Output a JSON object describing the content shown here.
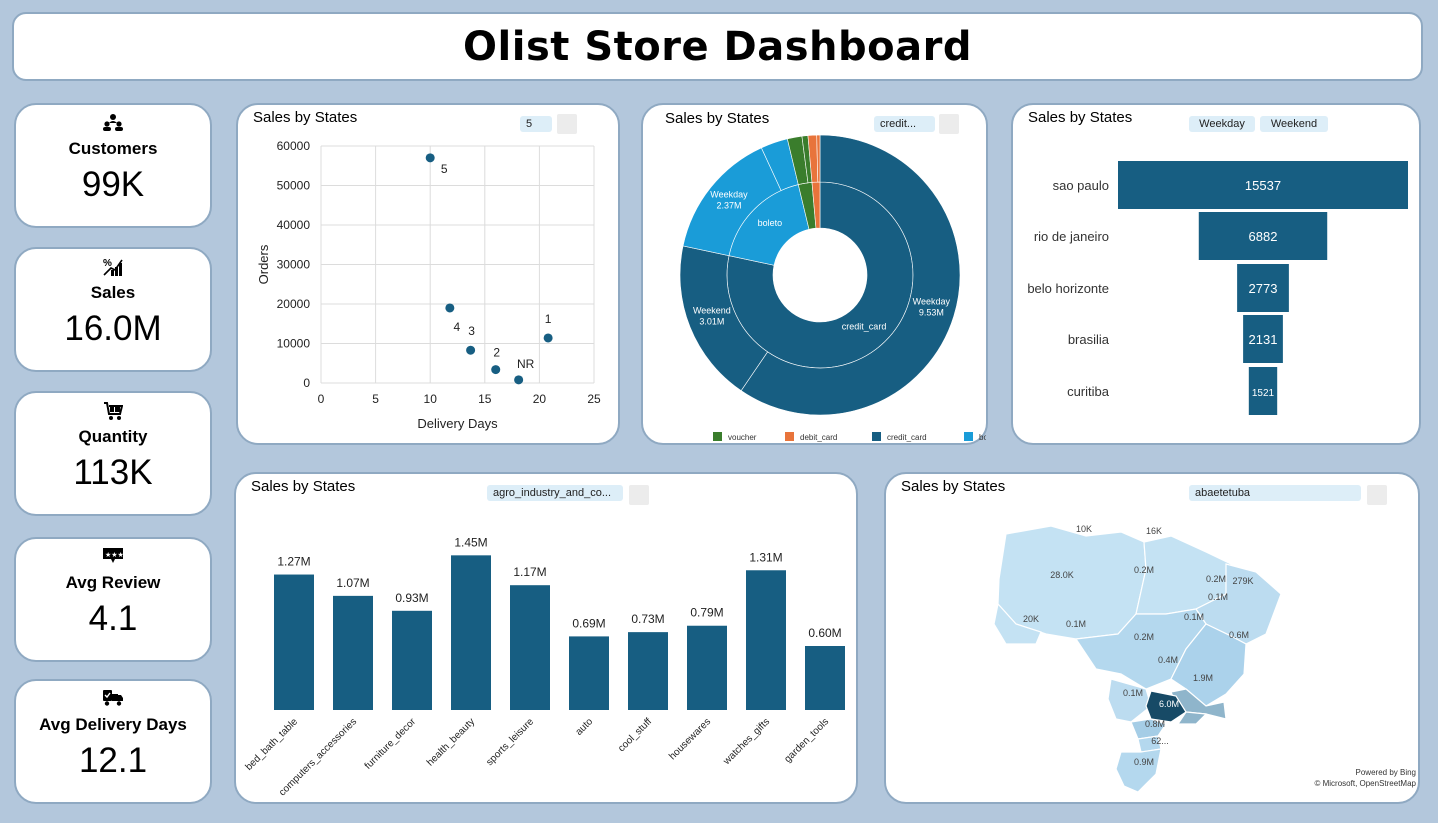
{
  "header": {
    "title": "Olist Store Dashboard"
  },
  "kpis": {
    "customers": {
      "label": "Customers",
      "value": "99K",
      "icon": "people-icon"
    },
    "sales": {
      "label": "Sales",
      "value": "16.0M",
      "icon": "sales-growth-icon"
    },
    "quantity": {
      "label": "Quantity",
      "value": "113K",
      "icon": "cart-icon"
    },
    "avg_review": {
      "label": "Avg Review",
      "value": "4.1",
      "icon": "star-review-icon"
    },
    "avg_delivery": {
      "label": "Avg Delivery Days",
      "value": "12.1",
      "icon": "delivery-truck-icon"
    }
  },
  "scatter": {
    "title": "Sales by States",
    "slicer": "5",
    "chart_data": {
      "type": "scatter",
      "xlabel": "Delivery Days",
      "ylabel": "Orders",
      "xlim": [
        0,
        25
      ],
      "ylim": [
        0,
        60000
      ],
      "x_ticks": [
        "0",
        "5",
        "10",
        "15",
        "20",
        "25"
      ],
      "y_ticks": [
        "0",
        "10000",
        "20000",
        "30000",
        "40000",
        "50000",
        "60000"
      ],
      "points": [
        {
          "label": "5",
          "x": 10.0,
          "y": 57000
        },
        {
          "label": "4",
          "x": 11.8,
          "y": 19000
        },
        {
          "label": "3",
          "x": 13.7,
          "y": 8300
        },
        {
          "label": "2",
          "x": 16.0,
          "y": 3400
        },
        {
          "label": "NR",
          "x": 18.1,
          "y": 800
        },
        {
          "label": "1",
          "x": 20.8,
          "y": 11400
        }
      ]
    }
  },
  "donut": {
    "title": "Sales by States",
    "slicer": "credit...",
    "legend": [
      {
        "label": "voucher",
        "color": "#3a7d2c"
      },
      {
        "label": "debit_card",
        "color": "#e8743b"
      },
      {
        "label": "credit_card",
        "color": "#175e82"
      },
      {
        "label": "boleto",
        "color": "#1a9cd8"
      }
    ],
    "chart_data": {
      "type": "pie",
      "inner": [
        {
          "label": "credit_card",
          "value": 12.54,
          "color": "#175e82"
        },
        {
          "label": "boleto",
          "value": 2.87,
          "color": "#1a9cd8"
        },
        {
          "label": "voucher",
          "value": 0.38,
          "color": "#3a7d2c"
        },
        {
          "label": "debit_card",
          "value": 0.22,
          "color": "#e8743b"
        }
      ],
      "outer": [
        {
          "label": "Weekday",
          "value_label": "9.53M",
          "value": 9.53,
          "color": "#175e82"
        },
        {
          "label": "Weekend",
          "value_label": "3.01M",
          "value": 3.01,
          "color": "#175e82"
        },
        {
          "label": "Weekday",
          "value_label": "2.37M",
          "value": 2.37,
          "color": "#1a9cd8"
        },
        {
          "label": "Weekend",
          "value_label": "",
          "value": 0.5,
          "color": "#1a9cd8"
        },
        {
          "label": "Weekday",
          "value_label": "",
          "value": 0.27,
          "color": "#3a7d2c"
        },
        {
          "label": "Weekend",
          "value_label": "",
          "value": 0.11,
          "color": "#3a7d2c"
        },
        {
          "label": "Weekday",
          "value_label": "",
          "value": 0.16,
          "color": "#e8743b"
        },
        {
          "label": "Weekend",
          "value_label": "",
          "value": 0.06,
          "color": "#e8743b"
        }
      ]
    }
  },
  "funnel": {
    "title": "Sales by States",
    "slicer_weekday": "Weekday",
    "slicer_weekend": "Weekend",
    "chart_data": {
      "type": "bar",
      "categories": [
        "sao paulo",
        "rio de janeiro",
        "belo horizonte",
        "brasilia",
        "curitiba"
      ],
      "values": [
        15537,
        6882,
        2773,
        2131,
        1521
      ],
      "labels": [
        "15537",
        "6882",
        "2773",
        "2131",
        "1521"
      ]
    }
  },
  "bars": {
    "title": "Sales by States",
    "slicer": "agro_industry_and_co...",
    "chart_data": {
      "type": "bar",
      "categories": [
        "bed_bath_table",
        "computers_accessories",
        "furniture_decor",
        "health_beauty",
        "sports_leisure",
        "auto",
        "cool_stuff",
        "housewares",
        "watches_gifts",
        "garden_tools"
      ],
      "values": [
        1.27,
        1.07,
        0.93,
        1.45,
        1.17,
        0.69,
        0.73,
        0.79,
        1.31,
        0.6
      ],
      "labels": [
        "1.27M",
        "1.07M",
        "0.93M",
        "1.45M",
        "1.17M",
        "0.69M",
        "0.73M",
        "0.79M",
        "1.31M",
        "0.60M"
      ],
      "ylim": [
        0,
        1.5
      ]
    }
  },
  "map": {
    "title": "Sales by States",
    "slicer": "abaetetuba",
    "credit1": "Powered by Bing",
    "credit2": "© Microsoft, OpenStreetMap",
    "region_labels": [
      "10K",
      "16K",
      "28.0K",
      "0.2M",
      "0.2M",
      "279K",
      "0.1M",
      "20K",
      "0.1M",
      "0.1M",
      "0.2M",
      "0.6M",
      "0.4M",
      "1.9M",
      "0.1M",
      "6.0M",
      "0.8M",
      "62...",
      "0.9M"
    ]
  }
}
